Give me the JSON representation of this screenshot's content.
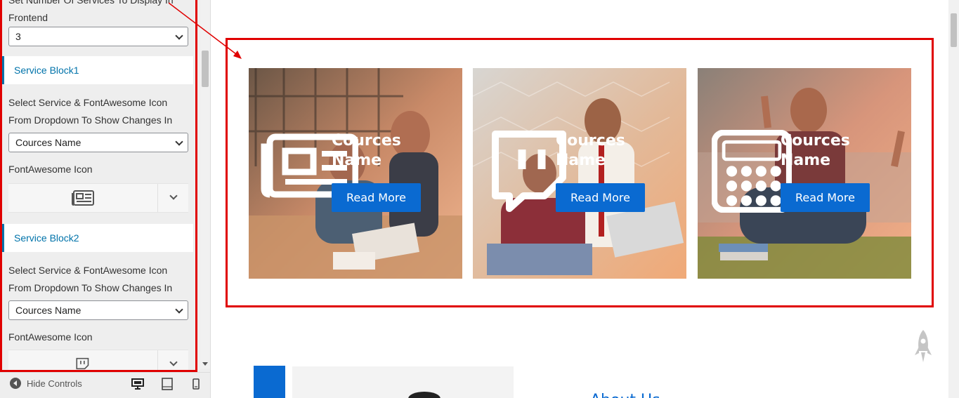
{
  "panel": {
    "number_label": "Set Number Of Services To Display In Frontend",
    "number_value": "3",
    "blocks": [
      {
        "title": "Service Block1",
        "select_label": "Select Service & FontAwesome Icon From Dropdown To Show Changes In Frontend",
        "service_value": "Cources Name",
        "icon_label": "FontAwesome Icon",
        "icon": "newspaper-icon"
      },
      {
        "title": "Service Block2",
        "select_label": "Select Service & FontAwesome Icon From Dropdown To Show Changes In Frontend",
        "service_value": "Cources Name",
        "icon_label": "FontAwesome Icon",
        "icon": "twitch-icon"
      }
    ]
  },
  "footer": {
    "hide_controls": "Hide Controls",
    "devices": [
      "desktop-icon",
      "tablet-icon",
      "mobile-icon"
    ]
  },
  "services": [
    {
      "title": "Cources Name",
      "button": "Read More",
      "icon": "newspaper-icon"
    },
    {
      "title": "Cources Name",
      "button": "Read More",
      "icon": "twitch-icon"
    },
    {
      "title": "Cources Name",
      "button": "Read More",
      "icon": "calculator-icon"
    }
  ],
  "about": {
    "heading": "About Us"
  },
  "colors": {
    "accent": "#0a6ad1",
    "highlight": "#e00000",
    "panel_link": "#0073aa"
  }
}
